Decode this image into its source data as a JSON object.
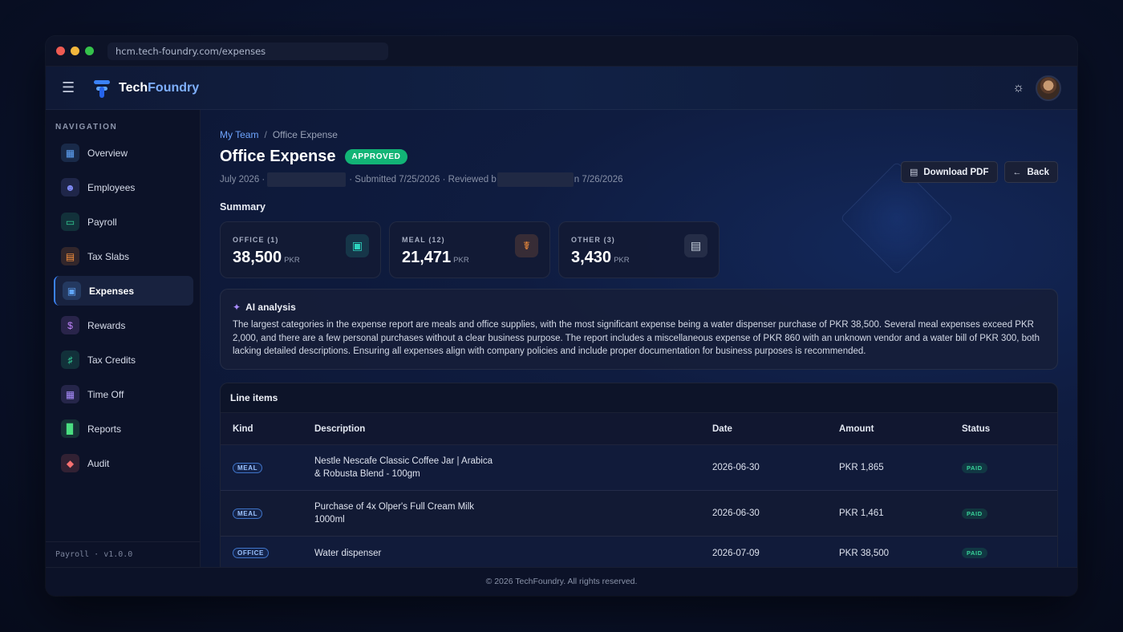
{
  "browser": {
    "url": "hcm.tech-foundry.com/expenses"
  },
  "app": {
    "brand_first": "Tech",
    "brand_second": "Foundry"
  },
  "sidebar": {
    "heading": "NAVIGATION",
    "items": [
      {
        "label": "Overview",
        "icon": "grid-icon",
        "icon_color": "#60a5fa"
      },
      {
        "label": "Employees",
        "icon": "users-icon",
        "icon_color": "#818cf8"
      },
      {
        "label": "Payroll",
        "icon": "card-icon",
        "icon_color": "#34d399"
      },
      {
        "label": "Tax Slabs",
        "icon": "document-icon",
        "icon_color": "#fb923c"
      },
      {
        "label": "Expenses",
        "icon": "wallet-icon",
        "icon_color": "#60a5fa"
      },
      {
        "label": "Rewards",
        "icon": "dollar-icon",
        "icon_color": "#c084fc"
      },
      {
        "label": "Tax Credits",
        "icon": "bank-icon",
        "icon_color": "#34d399"
      },
      {
        "label": "Time Off",
        "icon": "calendar-icon",
        "icon_color": "#a78bfa"
      },
      {
        "label": "Reports",
        "icon": "bar-chart-icon",
        "icon_color": "#4ade80"
      },
      {
        "label": "Audit",
        "icon": "shield-icon",
        "icon_color": "#f87171"
      }
    ],
    "active": "Expenses",
    "footer": "Payroll · v1.0.0"
  },
  "breadcrumb": {
    "parent": "My Team",
    "separator": "/",
    "current": "Office Expense"
  },
  "header": {
    "title": "Office Expense",
    "status": "APPROVED",
    "meta_period": "July 2026 ·",
    "meta_submitted": "· Submitted 7/25/2026 · Reviewed b",
    "meta_reviewed": "n 7/26/2026"
  },
  "actions": {
    "download": "Download PDF",
    "back": "Back"
  },
  "summary": {
    "title": "Summary",
    "cards": [
      {
        "label": "OFFICE (1)",
        "value": "38,500",
        "unit": "PKR",
        "icon": "briefcase-icon",
        "color": "#2dd4bf"
      },
      {
        "label": "MEAL (12)",
        "value": "21,471",
        "unit": "PKR",
        "icon": "utensils-icon",
        "color": "#fb923c"
      },
      {
        "label": "OTHER (3)",
        "value": "3,430",
        "unit": "PKR",
        "icon": "receipt-icon",
        "color": "#cbd5e1"
      }
    ]
  },
  "ai": {
    "title": "AI analysis",
    "text": "The largest categories in the expense report are meals and office supplies, with the most significant expense being a water dispenser purchase of PKR 38,500. Several meal expenses exceed PKR 2,000, and there are a few personal purchases without a clear business purpose. The report includes a miscellaneous expense of PKR 860 with an unknown vendor and a water bill of PKR 300, both lacking detailed descriptions. Ensuring all expenses align with company policies and include proper documentation for business purposes is recommended."
  },
  "line_items": {
    "title": "Line items",
    "columns": [
      "Kind",
      "Description",
      "Date",
      "Amount",
      "Status"
    ],
    "rows": [
      {
        "kind": "MEAL",
        "desc_1": "Nestle Nescafe Classic Coffee Jar | Arabica",
        "desc_2": "& Robusta Blend - 100gm",
        "date": "2026-06-30",
        "amount": "PKR 1,865",
        "status": "PAID"
      },
      {
        "kind": "MEAL",
        "desc_1": "Purchase of 4x Olper's Full Cream Milk",
        "desc_2": "1000ml",
        "date": "2026-06-30",
        "amount": "PKR 1,461",
        "status": "PAID"
      },
      {
        "kind": "OFFICE",
        "desc_1": "Water dispenser",
        "desc_2": "",
        "date": "2026-07-09",
        "amount": "PKR 38,500",
        "status": "PAID"
      }
    ]
  },
  "footer": {
    "text": "© 2026 TechFoundry. All rights reserved."
  }
}
